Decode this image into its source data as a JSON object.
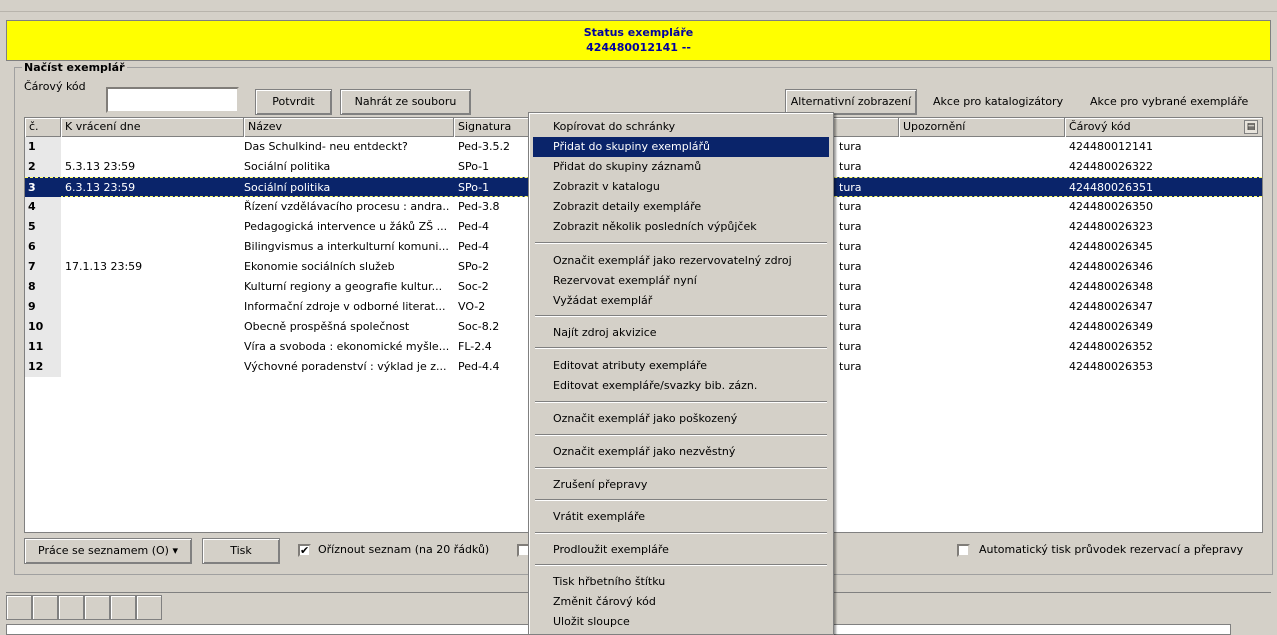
{
  "status": {
    "title": "Status exempláře",
    "barcode_line": "424480012141 --"
  },
  "load_panel": {
    "legend": "Načíst exemplář",
    "barcode_label": "Čárový kód",
    "barcode_value": "",
    "confirm_button": "Potvrdit",
    "upload_button": "Nahrát ze souboru",
    "alt_view_button": "Alternativní zobrazení",
    "cataloger_actions": "Akce pro katalogizátory",
    "selected_actions": "Akce pro vybrané exempláře"
  },
  "table": {
    "columns": [
      "č.",
      "K vrácení dne",
      "Název",
      "Signatura",
      "Upozornění",
      "Čárový kód"
    ],
    "rows": [
      {
        "n": "1",
        "due": "",
        "title": "Das Schulkind- neu entdeckt?",
        "sig": "Ped-3.5.2",
        "status": "tura",
        "barcode": "424480012141"
      },
      {
        "n": "2",
        "due": "5.3.13 23:59",
        "title": "Sociální politika",
        "sig": "SPo-1",
        "status": "tura",
        "barcode": "424480026322"
      },
      {
        "n": "3",
        "due": "6.3.13 23:59",
        "title": "Sociální politika",
        "sig": "SPo-1",
        "status": "tura",
        "barcode": "424480026351"
      },
      {
        "n": "4",
        "due": "",
        "title": "Řízení vzdělávacího procesu : andra...",
        "sig": "Ped-3.8",
        "status": "tura",
        "barcode": "424480026350"
      },
      {
        "n": "5",
        "due": "",
        "title": "Pedagogická intervence u žáků ZŠ ...",
        "sig": "Ped-4",
        "status": "tura",
        "barcode": "424480026323"
      },
      {
        "n": "6",
        "due": "",
        "title": "Bilingvismus a interkulturní komuni...",
        "sig": "Ped-4",
        "status": "tura",
        "barcode": "424480026345"
      },
      {
        "n": "7",
        "due": "17.1.13 23:59",
        "title": "Ekonomie sociálních služeb",
        "sig": "SPo-2",
        "status": "tura",
        "barcode": "424480026346"
      },
      {
        "n": "8",
        "due": "",
        "title": "Kulturní regiony a geografie kultur...",
        "sig": "Soc-2",
        "status": "tura",
        "barcode": "424480026348"
      },
      {
        "n": "9",
        "due": "",
        "title": "Informační zdroje v odborné literat...",
        "sig": "VO-2",
        "status": "tura",
        "barcode": "424480026347"
      },
      {
        "n": "10",
        "due": "",
        "title": "Obecně prospěšná společnost",
        "sig": "Soc-8.2",
        "status": "tura",
        "barcode": "424480026349"
      },
      {
        "n": "11",
        "due": "",
        "title": "Víra a svoboda : ekonomické myšle...",
        "sig": "FL-2.4",
        "status": "tura",
        "barcode": "424480026352"
      },
      {
        "n": "12",
        "due": "",
        "title": "Výchovné poradenství : výklad je z...",
        "sig": "Ped-4.4",
        "status": "tura",
        "barcode": "424480026353"
      }
    ],
    "selected_row": 3
  },
  "footer": {
    "list_work_button": "Práce se seznamem (O)",
    "print_button": "Tisk",
    "trim_checkbox_label": "Oříznout seznam (na 20 řádků)",
    "trim_checked": "✔",
    "auto_print_label": "Automatický tisk průvodek rezervací a přepravy"
  },
  "context_menu": {
    "items": [
      "Kopírovat do schránky",
      "Přidat do skupiny exemplářů",
      "Přidat do skupiny záznamů",
      "Zobrazit v katalogu",
      "Zobrazit detaily exempláře",
      "Zobrazit několik posledních výpůjček",
      "Označit exemplář jako rezervovatelný zdroj",
      "Rezervovat exemplář nyní",
      "Vyžádat exemplář",
      "Najít zdroj akvizice",
      "Editovat atributy exempláře",
      "Editovat exempláře/svazky bib. zázn.",
      "Označit exemplář jako poškozený",
      "Označit exemplář jako nezvěstný",
      "Zrušení přepravy",
      "Vrátit exempláře",
      "Prodloužit exempláře",
      "Tisk hřbetního štítku",
      "Změnit čárový kód",
      "Uložit sloupce"
    ],
    "highlighted": 1
  },
  "colors": {
    "status_bg": "#ffff00",
    "selection": "#0a246a",
    "window": "#d4d0c8"
  }
}
